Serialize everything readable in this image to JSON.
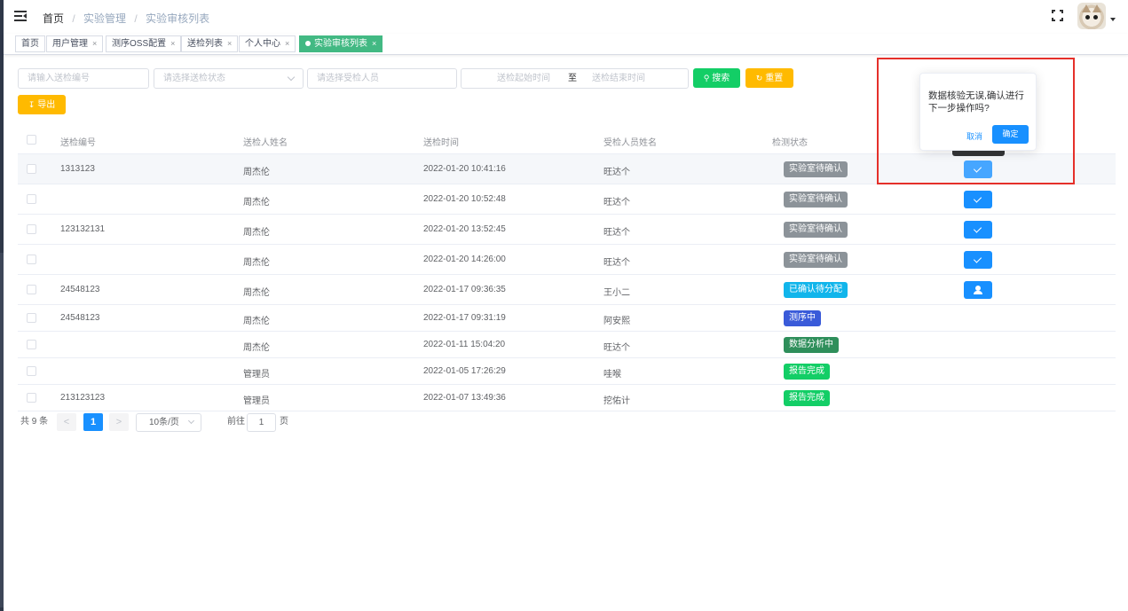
{
  "breadcrumb": {
    "home": "首页",
    "sep": "/",
    "section": "实验管理",
    "current": "实验审核列表"
  },
  "tags": [
    {
      "label": "首页",
      "closable": false
    },
    {
      "label": "用户管理",
      "closable": true
    },
    {
      "label": "测序OSS配置",
      "closable": true
    },
    {
      "label": "送检列表",
      "closable": true
    },
    {
      "label": "个人中心",
      "closable": true
    },
    {
      "label": "实验审核列表",
      "closable": true,
      "active": true
    }
  ],
  "tag_close": "×",
  "search": {
    "id_placeholder": "请输入送检编号",
    "status_placeholder": "请选择送检状态",
    "person_placeholder": "请选择受检人员",
    "start_placeholder": "送检起始时间",
    "range_sep": "至",
    "end_placeholder": "送检结束时间",
    "search_label": "搜索",
    "reset_label": "重置",
    "export_label": "导出"
  },
  "table": {
    "columns": [
      "送检编号",
      "送检人姓名",
      "送检时间",
      "受检人员姓名",
      "检测状态"
    ],
    "rows": [
      {
        "id": "1313123",
        "sender": "周杰伦",
        "time": "2022-01-20 10:41:16",
        "subject": "旺达个",
        "status": "实验室待确认",
        "action": "confirm"
      },
      {
        "id": "",
        "sender": "周杰伦",
        "time": "2022-01-20 10:52:48",
        "subject": "旺达个",
        "status": "实验室待确认",
        "action": "confirm"
      },
      {
        "id": "123132131",
        "sender": "周杰伦",
        "time": "2022-01-20 13:52:45",
        "subject": "旺达个",
        "status": "实验室待确认",
        "action": "confirm"
      },
      {
        "id": "",
        "sender": "周杰伦",
        "time": "2022-01-20 14:26:00",
        "subject": "旺达个",
        "status": "实验室待确认",
        "action": "confirm"
      },
      {
        "id": "24548123",
        "sender": "周杰伦",
        "time": "2022-01-17 09:36:35",
        "subject": "王小二",
        "status": "已确认待分配",
        "action": "assign"
      },
      {
        "id": "24548123",
        "sender": "周杰伦",
        "time": "2022-01-17 09:31:19",
        "subject": "阿安熙",
        "status": "测序中",
        "action": ""
      },
      {
        "id": "",
        "sender": "周杰伦",
        "time": "2022-01-11 15:04:20",
        "subject": "旺达个",
        "status": "数据分析中",
        "action": ""
      },
      {
        "id": "",
        "sender": "管理员",
        "time": "2022-01-05 17:26:29",
        "subject": "哇喉",
        "status": "报告完成",
        "action": ""
      },
      {
        "id": "213123123",
        "sender": "管理员",
        "time": "2022-01-07 13:49:36",
        "subject": "挖佑计",
        "status": "报告完成",
        "action": ""
      }
    ]
  },
  "status_colors": {
    "实验室待确认": "#8c9399",
    "已确认待分配": "#11b5eb",
    "测序中": "#3a5bd9",
    "数据分析中": "#2f8f5b",
    "报告完成": "#13ce66"
  },
  "accent_color": "#1890ff",
  "pagination": {
    "total": "共 9 条",
    "prev": "<",
    "page": "1",
    "next": ">",
    "size": "10条/页",
    "goto": "前往",
    "goto_value": "1",
    "page_unit": "页"
  },
  "popconfirm": {
    "message": "数据核验无误,确认进行下一步操作吗?",
    "cancel": "取消",
    "confirm": "确定"
  },
  "icons": {
    "menu": "hamburger-icon",
    "fullscreen": "fullscreen-icon",
    "search": "search-icon",
    "reset": "refresh-icon",
    "export": "download-icon",
    "confirm": "check-icon",
    "assign": "user-icon"
  }
}
